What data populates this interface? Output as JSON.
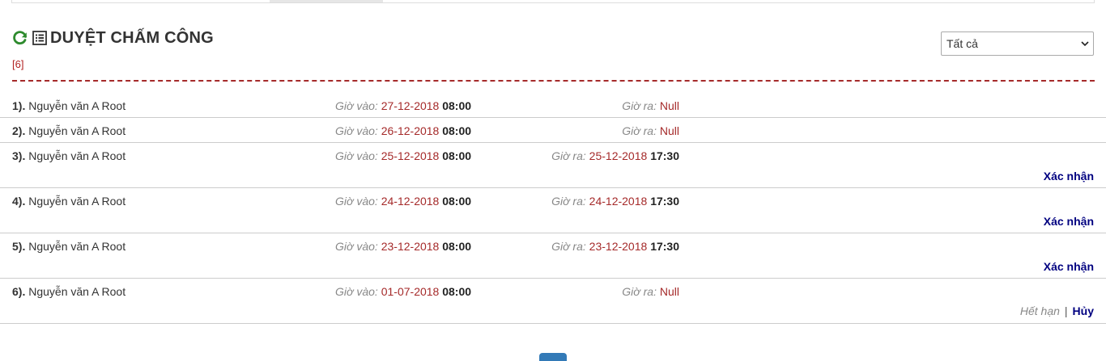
{
  "header": {
    "title": "DUYỆT CHẤM CÔNG",
    "count": "[6]"
  },
  "filter": {
    "selected": "Tất cả"
  },
  "labels": {
    "in": "Giờ vào:",
    "out": "Giờ ra:"
  },
  "rows": [
    {
      "index": "1).",
      "name": "Nguyễn văn A Root",
      "in_date": "27-12-2018",
      "in_time": "08:00",
      "out_date": "",
      "out_time": "",
      "out_null": "Null",
      "action": ""
    },
    {
      "index": "2).",
      "name": "Nguyễn văn A Root",
      "in_date": "26-12-2018",
      "in_time": "08:00",
      "out_date": "",
      "out_time": "",
      "out_null": "Null",
      "action": ""
    },
    {
      "index": "3).",
      "name": "Nguyễn văn A Root",
      "in_date": "25-12-2018",
      "in_time": "08:00",
      "out_date": "25-12-2018",
      "out_time": "17:30",
      "out_null": "",
      "action": "Xác nhận"
    },
    {
      "index": "4).",
      "name": "Nguyễn văn A Root",
      "in_date": "24-12-2018",
      "in_time": "08:00",
      "out_date": "24-12-2018",
      "out_time": "17:30",
      "out_null": "",
      "action": "Xác nhận"
    },
    {
      "index": "5).",
      "name": "Nguyễn văn A Root",
      "in_date": "23-12-2018",
      "in_time": "08:00",
      "out_date": "23-12-2018",
      "out_time": "17:30",
      "out_null": "",
      "action": "Xác nhận"
    },
    {
      "index": "6).",
      "name": "Nguyễn văn A Root",
      "in_date": "01-07-2018",
      "in_time": "08:00",
      "out_date": "",
      "out_time": "",
      "out_null": "Null",
      "action": ""
    }
  ],
  "row6_actions": {
    "expired": "Hết hạn",
    "separator": "|",
    "cancel": "Hủy"
  },
  "colors": {
    "accent_red": "#a52a2a",
    "link_navy": "#000080",
    "refresh_green": "#2e8b2e",
    "pager_blue": "#337ab7"
  }
}
